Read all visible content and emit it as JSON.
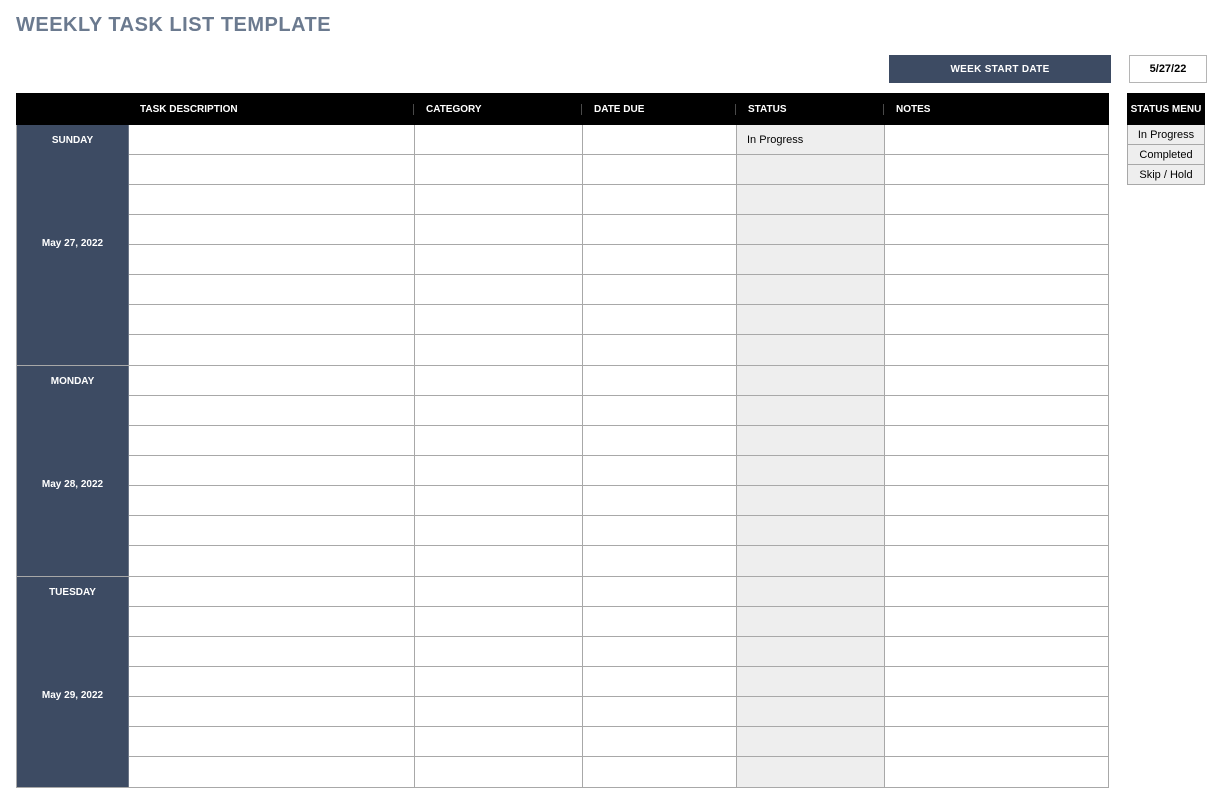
{
  "title": "WEEKLY TASK LIST TEMPLATE",
  "week_start": {
    "label": "WEEK START DATE",
    "value": "5/27/22"
  },
  "columns": {
    "task": "TASK DESCRIPTION",
    "category": "CATEGORY",
    "due": "DATE DUE",
    "status": "STATUS",
    "notes": "NOTES"
  },
  "status_menu": {
    "header": "STATUS MENU",
    "items": [
      "In Progress",
      "Completed",
      "Skip / Hold"
    ]
  },
  "days": [
    {
      "name": "SUNDAY",
      "date": "May 27, 2022",
      "rows": [
        {
          "task": "",
          "category": "",
          "due": "",
          "status": "In Progress",
          "notes": ""
        },
        {
          "task": "",
          "category": "",
          "due": "",
          "status": "",
          "notes": ""
        },
        {
          "task": "",
          "category": "",
          "due": "",
          "status": "",
          "notes": ""
        },
        {
          "task": "",
          "category": "",
          "due": "",
          "status": "",
          "notes": ""
        },
        {
          "task": "",
          "category": "",
          "due": "",
          "status": "",
          "notes": ""
        },
        {
          "task": "",
          "category": "",
          "due": "",
          "status": "",
          "notes": ""
        },
        {
          "task": "",
          "category": "",
          "due": "",
          "status": "",
          "notes": ""
        },
        {
          "task": "",
          "category": "",
          "due": "",
          "status": "",
          "notes": ""
        }
      ]
    },
    {
      "name": "MONDAY",
      "date": "May 28, 2022",
      "rows": [
        {
          "task": "",
          "category": "",
          "due": "",
          "status": "",
          "notes": ""
        },
        {
          "task": "",
          "category": "",
          "due": "",
          "status": "",
          "notes": ""
        },
        {
          "task": "",
          "category": "",
          "due": "",
          "status": "",
          "notes": ""
        },
        {
          "task": "",
          "category": "",
          "due": "",
          "status": "",
          "notes": ""
        },
        {
          "task": "",
          "category": "",
          "due": "",
          "status": "",
          "notes": ""
        },
        {
          "task": "",
          "category": "",
          "due": "",
          "status": "",
          "notes": ""
        },
        {
          "task": "",
          "category": "",
          "due": "",
          "status": "",
          "notes": ""
        }
      ]
    },
    {
      "name": "TUESDAY",
      "date": "May 29, 2022",
      "rows": [
        {
          "task": "",
          "category": "",
          "due": "",
          "status": "",
          "notes": ""
        },
        {
          "task": "",
          "category": "",
          "due": "",
          "status": "",
          "notes": ""
        },
        {
          "task": "",
          "category": "",
          "due": "",
          "status": "",
          "notes": ""
        },
        {
          "task": "",
          "category": "",
          "due": "",
          "status": "",
          "notes": ""
        },
        {
          "task": "",
          "category": "",
          "due": "",
          "status": "",
          "notes": ""
        },
        {
          "task": "",
          "category": "",
          "due": "",
          "status": "",
          "notes": ""
        },
        {
          "task": "",
          "category": "",
          "due": "",
          "status": "",
          "notes": ""
        }
      ]
    }
  ]
}
